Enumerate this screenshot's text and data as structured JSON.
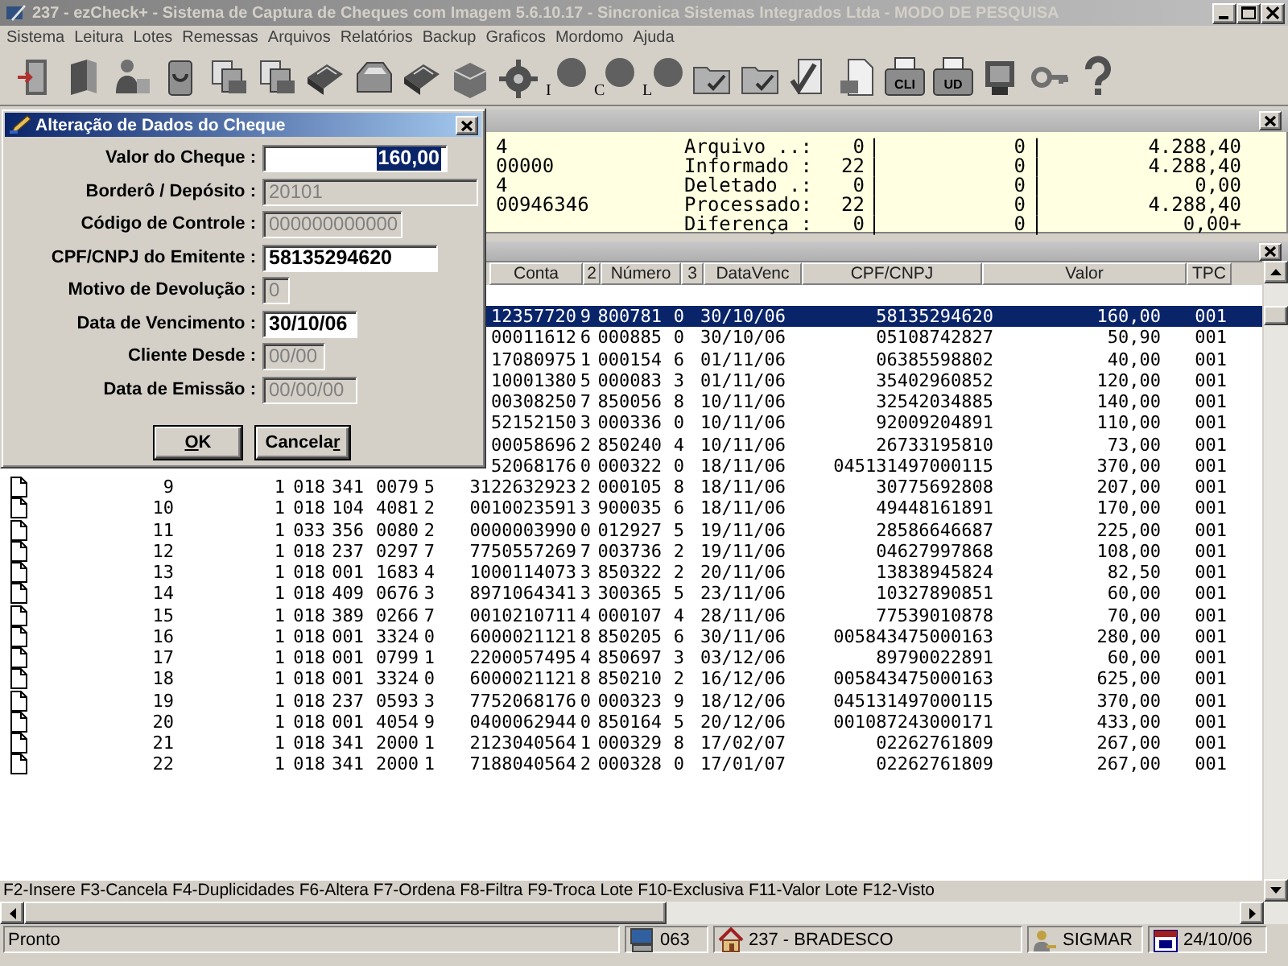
{
  "window": {
    "title": "237 - ezCheck+ - Sistema de Captura de Cheques com Imagem 5.6.10.17 - Sincronica Sistemas Integrados Ltda - MODO DE PESQUISA"
  },
  "menu": [
    "Sistema",
    "Leitura",
    "Lotes",
    "Remessas",
    "Arquivos",
    "Relatórios",
    "Backup",
    "Graficos",
    "Mordomo",
    "Ajuda"
  ],
  "toolbar": [
    {
      "kind": "door"
    },
    {
      "kind": "book"
    },
    {
      "kind": "person"
    },
    {
      "kind": "bin"
    },
    {
      "kind": "copy"
    },
    {
      "kind": "copy"
    },
    {
      "kind": "scanner"
    },
    {
      "kind": "tray"
    },
    {
      "kind": "scanner"
    },
    {
      "kind": "box"
    },
    {
      "kind": "gear"
    },
    {
      "kind": "disc",
      "label": "I"
    },
    {
      "kind": "disc",
      "label": "C"
    },
    {
      "kind": "disc",
      "label": "L"
    },
    {
      "kind": "folder"
    },
    {
      "kind": "folder"
    },
    {
      "kind": "check"
    },
    {
      "kind": "page"
    },
    {
      "kind": "printer",
      "label": "CLI"
    },
    {
      "kind": "printer",
      "label": "UD"
    },
    {
      "kind": "monitor"
    },
    {
      "kind": "key"
    },
    {
      "kind": "help"
    }
  ],
  "summary": {
    "rows": [
      {
        "fragment": "4",
        "label": "Arquivo ..:",
        "count": "0",
        "separator_1": "|",
        "count_2": "0",
        "separator_2": "|",
        "total": "4.288,40"
      },
      {
        "fragment": "00000",
        "label": "Informado :",
        "count": "22",
        "separator_1": "|",
        "count_2": "0",
        "separator_2": "|",
        "total": "4.288,40"
      },
      {
        "fragment": "4",
        "label": "Deletado .:",
        "count": "0",
        "separator_1": "|",
        "count_2": "0",
        "separator_2": "|",
        "total": "0,00"
      },
      {
        "fragment": "00946346",
        "label": "Processado:",
        "count": "22",
        "separator_1": "|",
        "count_2": "0",
        "separator_2": "|",
        "total": "4.288,40"
      },
      {
        "label": "Diferença :",
        "count": "0",
        "separator_1": "|",
        "count_2": "0",
        "separator_2": "|",
        "total": "0,00+"
      }
    ]
  },
  "table": {
    "columns": [
      "Conta",
      "2",
      "Número",
      "3",
      "DataVenc",
      "CPF/CNPJ",
      "Valor",
      "TPC"
    ],
    "rows": [
      {
        "selected": true,
        "cells": [
          "12357720",
          "9",
          "800781",
          "0",
          "30/10/06",
          "58135294620",
          "160,00",
          "001"
        ]
      },
      {
        "selected": false,
        "cells": [
          "00011612",
          "6",
          "000885",
          "0",
          "30/10/06",
          "05108742827",
          "50,90",
          "001"
        ]
      },
      {
        "selected": false,
        "cells": [
          "17080975",
          "1",
          "000154",
          "6",
          "01/11/06",
          "06385598802",
          "40,00",
          "001"
        ]
      },
      {
        "selected": false,
        "cells": [
          "10001380",
          "5",
          "000083",
          "3",
          "01/11/06",
          "35402960852",
          "120,00",
          "001"
        ]
      },
      {
        "selected": false,
        "cells": [
          "00308250",
          "7",
          "850056",
          "8",
          "10/11/06",
          "32542034885",
          "140,00",
          "001"
        ]
      },
      {
        "selected": false,
        "cells": [
          "52152150",
          "3",
          "000336",
          "0",
          "10/11/06",
          "92009204891",
          "110,00",
          "001"
        ]
      },
      {
        "selected": false,
        "cells": [
          "00058696",
          "2",
          "850240",
          "4",
          "10/11/06",
          "26733195810",
          "73,00",
          "001"
        ]
      },
      {
        "selected": false,
        "cells": [
          "52068176",
          "0",
          "000322",
          "0",
          "18/11/06",
          "045131497000115",
          "370,00",
          "001"
        ]
      },
      {
        "selected": false,
        "cells": [
          "9",
          "1",
          "018",
          "341",
          "0079",
          "5",
          "3122632923",
          "2",
          "000105",
          "8",
          "18/11/06",
          "30775692808",
          "207,00",
          "001"
        ]
      },
      {
        "selected": false,
        "cells": [
          "10",
          "1",
          "018",
          "104",
          "4081",
          "2",
          "0010023591",
          "3",
          "900035",
          "6",
          "18/11/06",
          "49448161891",
          "170,00",
          "001"
        ]
      },
      {
        "selected": false,
        "cells": [
          "11",
          "1",
          "033",
          "356",
          "0080",
          "2",
          "0000003990",
          "0",
          "012927",
          "5",
          "19/11/06",
          "28586646687",
          "225,00",
          "001"
        ]
      },
      {
        "selected": false,
        "cells": [
          "12",
          "1",
          "018",
          "237",
          "0297",
          "7",
          "7750557269",
          "7",
          "003736",
          "2",
          "19/11/06",
          "04627997868",
          "108,00",
          "001"
        ]
      },
      {
        "selected": false,
        "cells": [
          "13",
          "1",
          "018",
          "001",
          "1683",
          "4",
          "1000114073",
          "3",
          "850322",
          "2",
          "20/11/06",
          "13838945824",
          "82,50",
          "001"
        ]
      },
      {
        "selected": false,
        "cells": [
          "14",
          "1",
          "018",
          "409",
          "0676",
          "3",
          "8971064341",
          "3",
          "300365",
          "5",
          "23/11/06",
          "10327890851",
          "60,00",
          "001"
        ]
      },
      {
        "selected": false,
        "cells": [
          "15",
          "1",
          "018",
          "389",
          "0266",
          "7",
          "0010210711",
          "4",
          "000107",
          "4",
          "28/11/06",
          "77539010878",
          "70,00",
          "001"
        ]
      },
      {
        "selected": false,
        "cells": [
          "16",
          "1",
          "018",
          "001",
          "3324",
          "0",
          "6000021121",
          "8",
          "850205",
          "6",
          "30/11/06",
          "005843475000163",
          "280,00",
          "001"
        ]
      },
      {
        "selected": false,
        "cells": [
          "17",
          "1",
          "018",
          "001",
          "0799",
          "1",
          "2200057495",
          "4",
          "850697",
          "3",
          "03/12/06",
          "89790022891",
          "60,00",
          "001"
        ]
      },
      {
        "selected": false,
        "cells": [
          "18",
          "1",
          "018",
          "001",
          "3324",
          "0",
          "6000021121",
          "8",
          "850210",
          "2",
          "16/12/06",
          "005843475000163",
          "625,00",
          "001"
        ]
      },
      {
        "selected": false,
        "cells": [
          "19",
          "1",
          "018",
          "237",
          "0593",
          "3",
          "7752068176",
          "0",
          "000323",
          "9",
          "18/12/06",
          "045131497000115",
          "370,00",
          "001"
        ]
      },
      {
        "selected": false,
        "cells": [
          "20",
          "1",
          "018",
          "001",
          "4054",
          "9",
          "0400062944",
          "0",
          "850164",
          "5",
          "20/12/06",
          "001087243000171",
          "433,00",
          "001"
        ]
      },
      {
        "selected": false,
        "cells": [
          "21",
          "1",
          "018",
          "341",
          "2000",
          "1",
          "2123040564",
          "1",
          "000329",
          "8",
          "17/02/07",
          "02262761809",
          "267,00",
          "001"
        ]
      },
      {
        "selected": false,
        "cells": [
          "22",
          "1",
          "018",
          "341",
          "2000",
          "1",
          "7188040564",
          "2",
          "000328",
          "0",
          "17/01/07",
          "02262761809",
          "267,00",
          "001"
        ]
      }
    ]
  },
  "function_keys": "F2-Insere F3-Cancela F4-Duplicidades F6-Altera F7-Ordena F8-Filtra F9-Troca Lote F10-Exclusiva F11-Valor Lote F12-Visto",
  "status_bar": [
    {
      "kind": "text",
      "text": "Pronto"
    },
    {
      "kind": "computer",
      "text": "063"
    },
    {
      "kind": "house",
      "text": "237 - BRADESCO"
    },
    {
      "kind": "user",
      "text": "SIGMAR"
    },
    {
      "kind": "calendar",
      "text": "24/10/06"
    }
  ],
  "dialog": {
    "title": "Alteração de Dados do Cheque",
    "fields": [
      {
        "label": "Valor do Cheque :",
        "value": "160,00",
        "disabled": false,
        "text_selected": true
      },
      {
        "label": "Borderô / Depósito :",
        "value": "20101",
        "disabled": true,
        "text_selected": false
      },
      {
        "label": "Código de Controle :",
        "value": "000000000000",
        "disabled": true,
        "text_selected": false
      },
      {
        "label": "CPF/CNPJ do Emitente :",
        "value": "58135294620",
        "disabled": false,
        "text_selected": false
      },
      {
        "label": "Motivo de Devolução :",
        "value": "0",
        "disabled": true,
        "text_selected": false
      },
      {
        "label": "Data de Vencimento :",
        "value": "30/10/06",
        "disabled": false,
        "text_selected": false
      },
      {
        "label": "Cliente Desde :",
        "value": "00/00",
        "disabled": true,
        "text_selected": false
      },
      {
        "label": "Data de Emissão :",
        "value": "00/00/00",
        "disabled": true,
        "text_selected": false
      }
    ],
    "buttons": [
      {
        "label": "OK"
      },
      {
        "label": "Cancelar"
      }
    ]
  }
}
